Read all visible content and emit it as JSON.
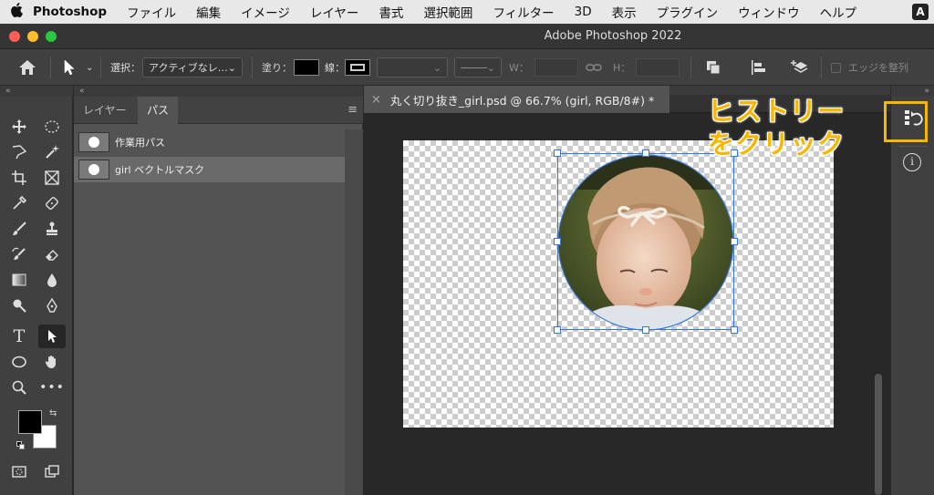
{
  "menubar": {
    "app_name": "Photoshop",
    "items": [
      "ファイル",
      "編集",
      "イメージ",
      "レイヤー",
      "書式",
      "選択範囲",
      "フィルター",
      "3D",
      "表示",
      "プラグイン",
      "ウィンドウ",
      "ヘルプ"
    ],
    "input_badge": "A"
  },
  "window": {
    "title": "Adobe Photoshop 2022"
  },
  "options": {
    "select_label": "選択：",
    "select_value": "アクティブなレ…",
    "fill_label": "塗り：",
    "stroke_label": "線：",
    "w_label": "W：",
    "h_label": "H：",
    "align_edges_label": "エッジを整列"
  },
  "panel": {
    "tabs": [
      "レイヤー",
      "パス"
    ],
    "active_tab": "パス",
    "paths": [
      {
        "name": "作業用パス",
        "selected": false
      },
      {
        "name": "girl ベクトルマスク",
        "selected": true
      }
    ]
  },
  "document": {
    "tab_title": "丸く切り抜き_girl.psd @ 66.7% (girl, RGB/8#) *",
    "close_glyph": "×"
  },
  "annotation": {
    "line1": "ヒストリー",
    "line2": "をクリック",
    "color": "#f5b700"
  },
  "colors": {
    "foreground": "#000000",
    "background": "#ffffff",
    "accent_selection": "#3a78d6"
  },
  "icons": [
    "apple-icon",
    "home-icon",
    "path-select-icon",
    "history-icon",
    "info-icon"
  ]
}
